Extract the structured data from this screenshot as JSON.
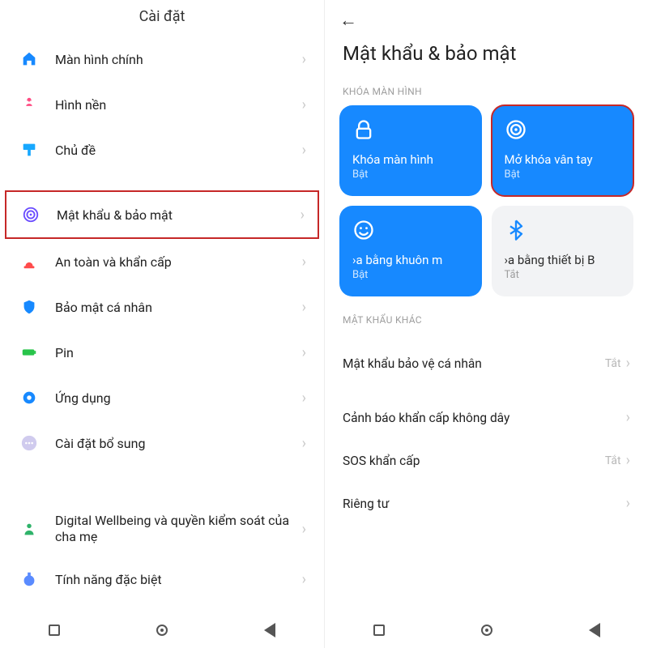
{
  "left": {
    "title": "Cài đặt",
    "groups": [
      [
        {
          "id": "home",
          "label": "Màn hình chính",
          "icon": "home-icon",
          "color": "#1789ff"
        },
        {
          "id": "wallpaper",
          "label": "Hình nền",
          "icon": "flower-icon",
          "color": "#ff4b82"
        },
        {
          "id": "themes",
          "label": "Chủ đề",
          "icon": "brush-icon",
          "color": "#17a8ff"
        }
      ],
      [
        {
          "id": "password-security",
          "label": "Mật khẩu & bảo mật",
          "icon": "fingerprint-icon",
          "color": "#6a4cff",
          "highlight": true
        },
        {
          "id": "safety-emergency",
          "label": "An toàn và khẩn cấp",
          "icon": "siren-icon",
          "color": "#ff4b4b"
        },
        {
          "id": "privacy",
          "label": "Bảo mật cá nhân",
          "icon": "shield-icon",
          "color": "#1789ff"
        },
        {
          "id": "battery",
          "label": "Pin",
          "icon": "battery-icon",
          "color": "#28c44a"
        },
        {
          "id": "apps",
          "label": "Ứng dụng",
          "icon": "gear-icon",
          "color": "#1789ff"
        },
        {
          "id": "additional",
          "label": "Cài đặt bổ sung",
          "icon": "dots-icon",
          "color": "#b9b4e6"
        }
      ],
      [
        {
          "id": "wellbeing",
          "label": "Digital Wellbeing và quyền kiểm soát của cha mẹ",
          "icon": "wellbeing-icon",
          "color": "#2fb36a"
        },
        {
          "id": "special",
          "label": "Tính năng đặc biệt",
          "icon": "potion-icon",
          "color": "#5a8bff"
        }
      ]
    ]
  },
  "right": {
    "back": "←",
    "title": "Mật khẩu & bảo mật",
    "section1": "KHÓA MÀN HÌNH",
    "tiles": [
      {
        "id": "screen-lock",
        "title": "Khóa màn hình",
        "status": "Bật",
        "state": "on",
        "icon": "lock-icon"
      },
      {
        "id": "fingerprint",
        "title": "Mở khóa vân tay",
        "status": "Bật",
        "state": "on",
        "icon": "fingerprint-ring-icon",
        "redbox": true
      },
      {
        "id": "face",
        "title": "›a bằng khuôn m",
        "status": "Bật",
        "state": "on",
        "icon": "face-icon"
      },
      {
        "id": "bluetooth",
        "title": "›a bằng thiết bị B",
        "status": "Tắt",
        "state": "off",
        "icon": "bluetooth-icon"
      }
    ],
    "section2": "MẬT KHẨU KHÁC",
    "rows": [
      {
        "id": "privacy-pw",
        "label": "Mật khẩu bảo vệ cá nhân",
        "value": "Tắt"
      },
      {
        "id": "wireless-alert",
        "label": "Cảnh báo khẩn cấp không dây",
        "value": ""
      },
      {
        "id": "sos",
        "label": "SOS khẩn cấp",
        "value": "Tắt"
      },
      {
        "id": "private",
        "label": "Riêng tư",
        "value": ""
      }
    ]
  }
}
